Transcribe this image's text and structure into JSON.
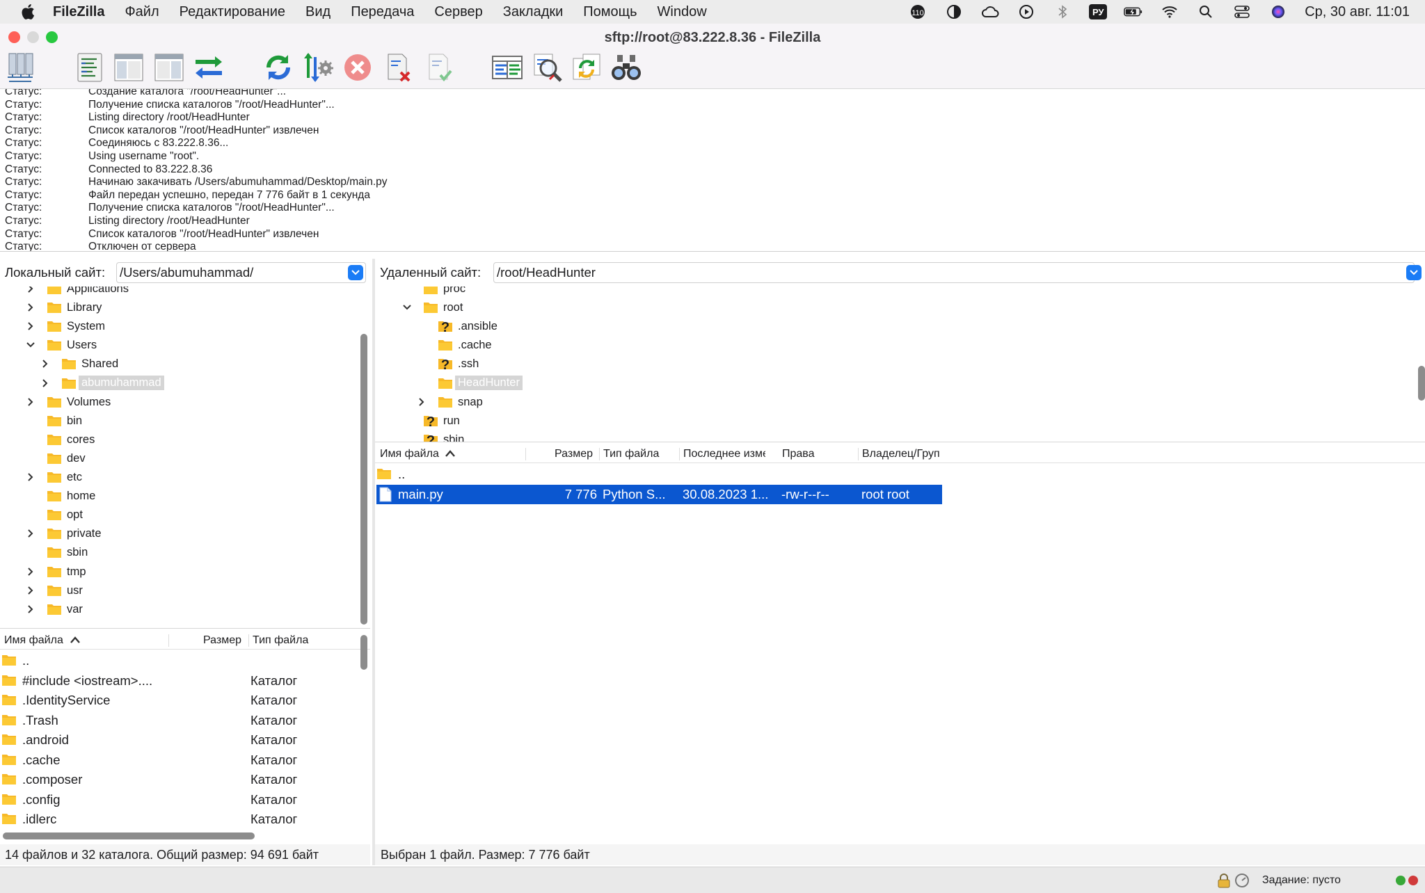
{
  "menubar": {
    "app_name": "FileZilla",
    "items": [
      "Файл",
      "Редактирование",
      "Вид",
      "Передача",
      "Сервер",
      "Закладки",
      "Помощь",
      "Window"
    ],
    "battery_badge": "110",
    "lang": "РУ",
    "clock": "Ср, 30 авг. 11:01"
  },
  "window": {
    "title": "sftp://root@83.222.8.36 - FileZilla"
  },
  "toolbar": {
    "icons": [
      "site-manager-icon",
      "toggle-log-icon",
      "toggle-local-tree-icon",
      "toggle-remote-tree-icon",
      "toggle-queue-icon",
      "refresh-icon",
      "process-queue-icon",
      "cancel-icon",
      "disconnect-icon",
      "reconnect-icon",
      "directory-comparison-icon",
      "search-icon",
      "sync-browsing-icon",
      "find-files-icon"
    ]
  },
  "log": {
    "lines": [
      {
        "tag": "Статус:",
        "msg": "Создание каталога \"/root/HeadHunter\"..."
      },
      {
        "tag": "Статус:",
        "msg": "Получение списка каталогов \"/root/HeadHunter\"..."
      },
      {
        "tag": "Статус:",
        "msg": "Listing directory /root/HeadHunter"
      },
      {
        "tag": "Статус:",
        "msg": "Список каталогов \"/root/HeadHunter\" извлечен"
      },
      {
        "tag": "Статус:",
        "msg": "Соединяюсь с 83.222.8.36..."
      },
      {
        "tag": "Статус:",
        "msg": "Using username \"root\"."
      },
      {
        "tag": "Статус:",
        "msg": "Connected to 83.222.8.36"
      },
      {
        "tag": "Статус:",
        "msg": "Начинаю закачивать /Users/abumuhammad/Desktop/main.py"
      },
      {
        "tag": "Статус:",
        "msg": "Файл передан успешно, передан 7 776 байт в 1 секунда"
      },
      {
        "tag": "Статус:",
        "msg": "Получение списка каталогов \"/root/HeadHunter\"..."
      },
      {
        "tag": "Статус:",
        "msg": "Listing directory /root/HeadHunter"
      },
      {
        "tag": "Статус:",
        "msg": "Список каталогов \"/root/HeadHunter\" извлечен"
      },
      {
        "tag": "Статус:",
        "msg": "Отключен от сервера"
      }
    ]
  },
  "local": {
    "label": "Локальный сайт:",
    "path": "/Users/abumuhammad/",
    "tree": [
      {
        "name": "Applications",
        "chevron": "right"
      },
      {
        "name": "Library",
        "chevron": "right"
      },
      {
        "name": "System",
        "chevron": "right"
      },
      {
        "name": "Users",
        "chevron": "down"
      },
      {
        "name": "Shared",
        "chevron": "right"
      },
      {
        "name": "abumuhammad",
        "chevron": "right"
      },
      {
        "name": "Volumes",
        "chevron": "right"
      },
      {
        "name": "bin",
        "chevron": ""
      },
      {
        "name": "cores",
        "chevron": ""
      },
      {
        "name": "dev",
        "chevron": ""
      },
      {
        "name": "etc",
        "chevron": "right"
      },
      {
        "name": "home",
        "chevron": ""
      },
      {
        "name": "opt",
        "chevron": ""
      },
      {
        "name": "private",
        "chevron": "right"
      },
      {
        "name": "sbin",
        "chevron": ""
      },
      {
        "name": "tmp",
        "chevron": "right"
      },
      {
        "name": "usr",
        "chevron": "right"
      },
      {
        "name": "var",
        "chevron": "right"
      }
    ],
    "columns": {
      "name": "Имя файла",
      "size": "Размер",
      "type": "Тип файла"
    },
    "files": [
      {
        "name": "..",
        "type": ""
      },
      {
        "name": "#include <iostream>....",
        "type": "Каталог"
      },
      {
        "name": ".IdentityService",
        "type": "Каталог"
      },
      {
        "name": ".Trash",
        "type": "Каталог"
      },
      {
        "name": ".android",
        "type": "Каталог"
      },
      {
        "name": ".cache",
        "type": "Каталог"
      },
      {
        "name": ".composer",
        "type": "Каталог"
      },
      {
        "name": ".config",
        "type": "Каталог"
      },
      {
        "name": ".idlerc",
        "type": "Каталог"
      }
    ],
    "status": "14 файлов и 32 каталога. Общий размер: 94 691 байт"
  },
  "remote": {
    "label": "Удаленный сайт:",
    "path": "/root/HeadHunter",
    "tree": [
      {
        "name": "proc",
        "chevron": "",
        "icon": "folder"
      },
      {
        "name": "root",
        "chevron": "down",
        "icon": "folder"
      },
      {
        "name": ".ansible",
        "chevron": "",
        "icon": "unknown"
      },
      {
        "name": ".cache",
        "chevron": "",
        "icon": "folder"
      },
      {
        "name": ".ssh",
        "chevron": "",
        "icon": "unknown"
      },
      {
        "name": "HeadHunter",
        "chevron": "",
        "icon": "folder"
      },
      {
        "name": "snap",
        "chevron": "right",
        "icon": "folder"
      },
      {
        "name": "run",
        "chevron": "",
        "icon": "unknown"
      },
      {
        "name": "sbin",
        "chevron": "",
        "icon": "unknown"
      }
    ],
    "columns": {
      "name": "Имя файла",
      "size": "Размер",
      "type": "Тип файла",
      "modified": "Последнее измен",
      "perms": "Права",
      "owner": "Владелец/Груп"
    },
    "files": [
      {
        "name": "..",
        "size": "",
        "type": "",
        "modified": "",
        "perms": "",
        "owner": ""
      },
      {
        "name": "main.py",
        "size": "7 776",
        "type": "Python S...",
        "modified": "30.08.2023 1...",
        "perms": "-rw-r--r--",
        "owner": "root root"
      }
    ],
    "status": "Выбран 1 файл. Размер: 7 776 байт"
  },
  "bottom": {
    "queue": "Задание: пусто"
  },
  "colors": {
    "accent": "#1b7cf6",
    "selection": "#0b57d0",
    "folder": "#f7b928",
    "close": "#fe5f57",
    "minimize": "#d9d9d9",
    "maximize": "#28c840"
  }
}
